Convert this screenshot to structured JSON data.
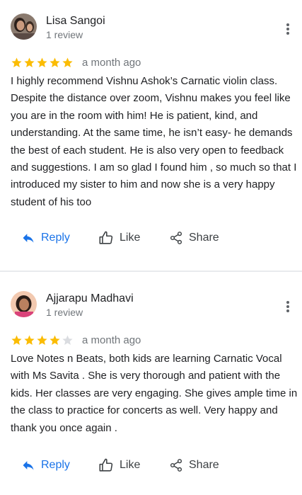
{
  "reviews": [
    {
      "reviewer_name": "Lisa Sangoi",
      "review_count": "1 review",
      "rating": 5,
      "date": "a month ago",
      "text": "I highly recommend Vishnu Ashok’s Carnatic violin class. Despite the distance over zoom, Vishnu makes you feel like you are in the room with him! He is patient, kind, and understanding. At the same time, he isn’t easy- he demands the best of each student. He is also very open to feedback and suggestions. I am so glad I found him , so much so that I introduced my sister to him and now she is a very happy student of his too",
      "actions": {
        "reply": "Reply",
        "like": "Like",
        "share": "Share"
      },
      "avatar_icon": "profile-photo-icon"
    },
    {
      "reviewer_name": "Ajjarapu Madhavi",
      "review_count": "1 review",
      "rating": 4,
      "date": "a month ago",
      "text": "Love Notes n Beats, both kids are learning Carnatic Vocal with Ms Savita . She is very thorough and patient with the kids. Her classes are very engaging. She gives ample time in the class to practice for concerts as well. Very happy and thank you once again .",
      "actions": {
        "reply": "Reply",
        "like": "Like",
        "share": "Share"
      },
      "avatar_icon": "profile-photo-icon"
    }
  ],
  "rating_max": 5,
  "icons": {
    "more": "more-vert-icon",
    "reply": "reply-arrow-icon",
    "like": "thumb-up-icon",
    "share": "share-icon",
    "star": "star-icon"
  },
  "colors": {
    "star_filled": "#fbbc04",
    "star_empty": "#dadce0",
    "reply_accent": "#1a73e8",
    "secondary_text": "#70757a",
    "primary_text": "#202124",
    "divider": "#e8eaed"
  }
}
